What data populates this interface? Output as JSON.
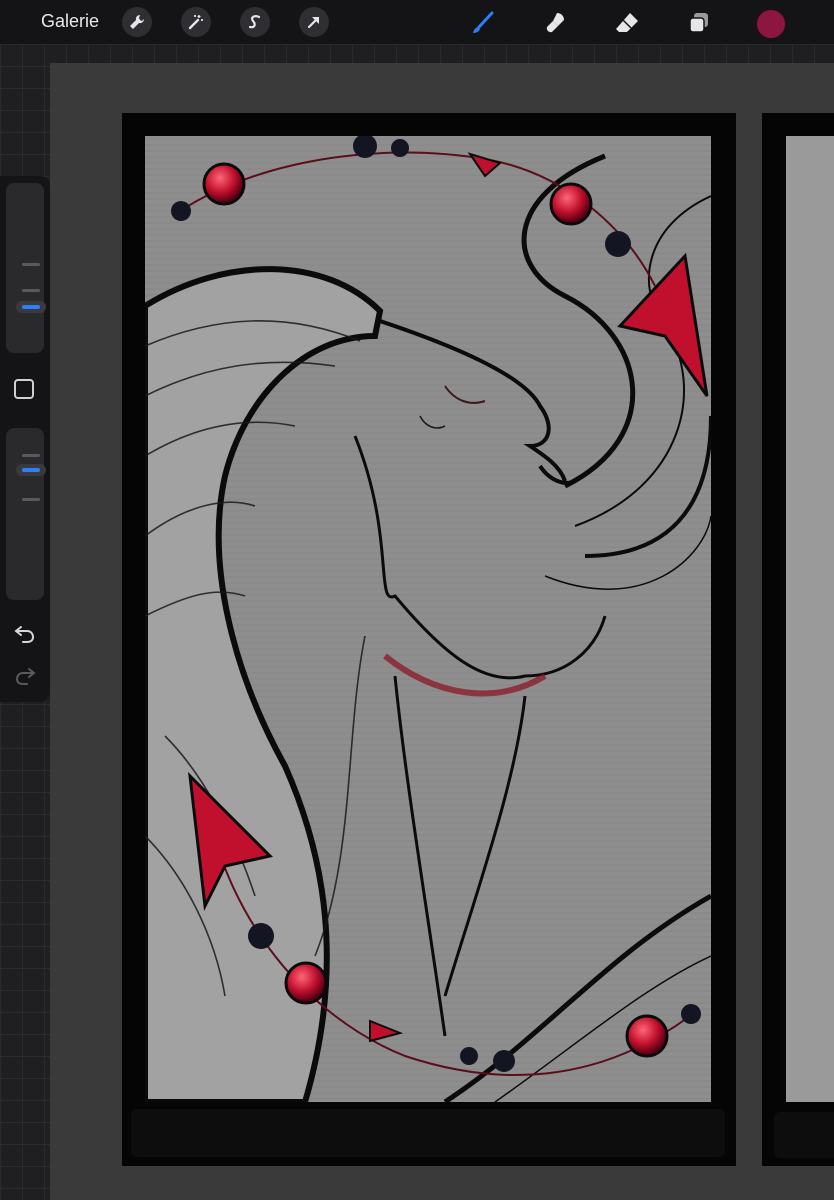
{
  "toolbar": {
    "gallery_label": "Galerie",
    "left_tools": [
      "wrench-icon",
      "magic-wand-icon",
      "selection-s-icon",
      "transform-arrow-icon"
    ],
    "right_tools": [
      "brush-icon",
      "smudge-icon",
      "eraser-icon",
      "layers-icon"
    ],
    "active_tool": "brush-icon",
    "active_color": "#8c1640",
    "brush_accent": "#2d7ff9"
  },
  "sidebar": {
    "brush_size_level": 0.62,
    "opacity_level": 0.8,
    "controls": [
      "brush-size-slider",
      "modify-square-button",
      "opacity-slider",
      "undo-button",
      "redo-button"
    ]
  },
  "canvas": {
    "artwork_description_colors": [
      "#8f8e8e",
      "#0b0b0b",
      "#c0102d"
    ]
  }
}
